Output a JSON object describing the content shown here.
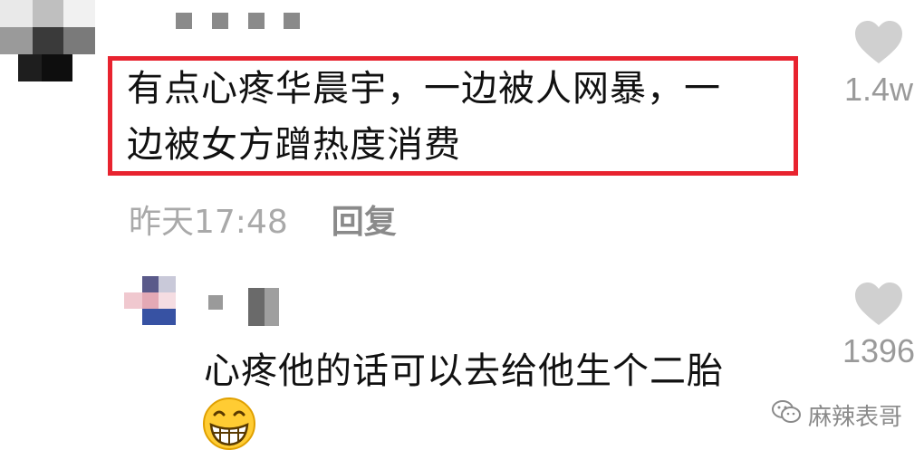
{
  "comments": [
    {
      "text_line1": "有点心疼华晨宇，一边被人网暴，一",
      "text_line2": "边被女方蹭热度消费",
      "time": "昨天17:48",
      "reply_label": "回复",
      "likes": "1.4w",
      "highlighted": true
    },
    {
      "text": "心疼他的话可以去给他生个二胎",
      "likes": "1396",
      "emoji": "grinning-face"
    }
  ],
  "watermark": {
    "text": "麻辣表哥",
    "icon": "wechat-icon"
  },
  "colors": {
    "highlight": "#e8232f",
    "heart": "#d0d0d0",
    "muted_text": "#a9a9a9"
  }
}
